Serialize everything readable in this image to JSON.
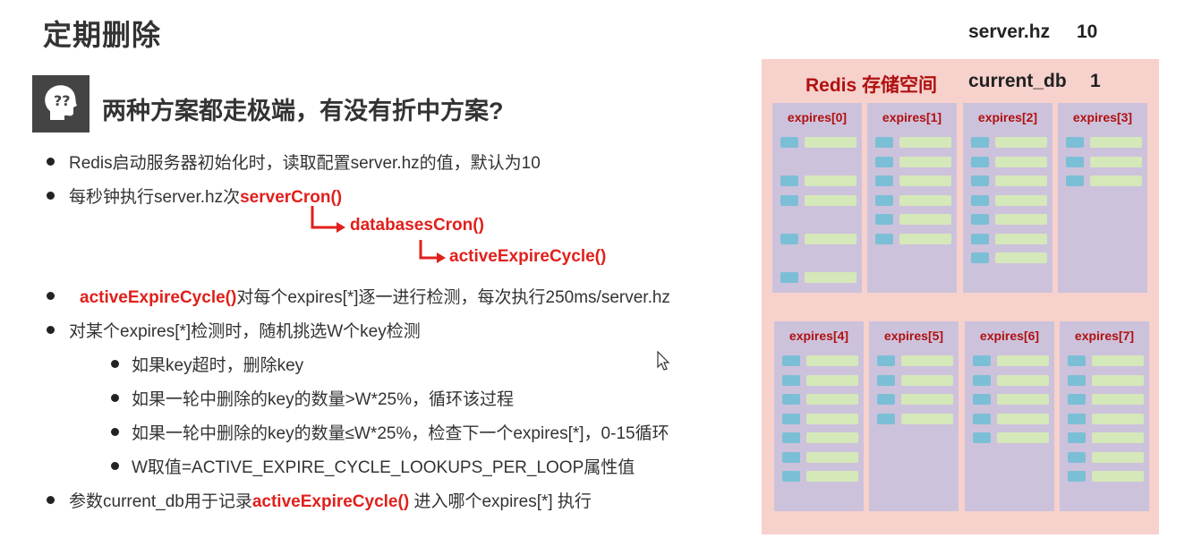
{
  "title": "定期删除",
  "server_hz": {
    "label": "server.hz",
    "value": "10"
  },
  "heading": "两种方案都走极端，有没有折中方案?",
  "bullets": {
    "b1": "Redis启动服务器初始化时，读取配置server.hz的值，默认为10",
    "b2_prefix": "每秒钟执行server.hz次",
    "b2_func": "serverCron()",
    "chain1": "databasesCron()",
    "chain2": "activeExpireCycle()",
    "b3_func": "activeExpireCycle()",
    "b3_text": "对每个expires[*]逐一进行检测，每次执行250ms/server.hz",
    "b4": "对某个expires[*]检测时，随机挑选W个key检测",
    "s1": "如果key超时，删除key",
    "s2": "如果一轮中删除的key的数量>W*25%，循环该过程",
    "s3": "如果一轮中删除的key的数量≤W*25%，检查下一个expires[*]，0-15循环",
    "s4": "W取值=ACTIVE_EXPIRE_CYCLE_LOOKUPS_PER_LOOP属性值",
    "b5_prefix": "参数current_db用于记录",
    "b5_func": "activeExpireCycle()",
    "b5_suffix": " 进入哪个expires[*] 执行"
  },
  "panel": {
    "title": "Redis 存储空间",
    "current_db_label": "current_db",
    "current_db_value": "1",
    "expires": [
      {
        "label": "expires[0]",
        "rows": [
          0,
          2,
          3,
          5,
          7
        ]
      },
      {
        "label": "expires[1]",
        "rows": [
          0,
          1,
          2,
          3,
          4,
          5
        ]
      },
      {
        "label": "expires[2]",
        "rows": [
          0,
          1,
          2,
          3,
          4,
          5,
          6
        ]
      },
      {
        "label": "expires[3]",
        "rows": [
          0,
          1,
          2
        ]
      },
      {
        "label": "expires[4]",
        "rows": [
          0,
          1,
          2,
          3,
          4,
          5,
          6
        ]
      },
      {
        "label": "expires[5]",
        "rows": [
          0,
          1,
          2,
          3
        ]
      },
      {
        "label": "expires[6]",
        "rows": [
          0,
          1,
          2,
          3,
          4
        ]
      },
      {
        "label": "expires[7]",
        "rows": [
          0,
          1,
          2,
          3,
          4,
          5,
          6
        ]
      }
    ]
  },
  "colors": {
    "accent_red": "#e0201c",
    "panel_bg": "#f7d1cc",
    "column_bg": "#cdc2dc",
    "key_blue": "#7bbfd6",
    "value_green": "#d5e8b9"
  }
}
